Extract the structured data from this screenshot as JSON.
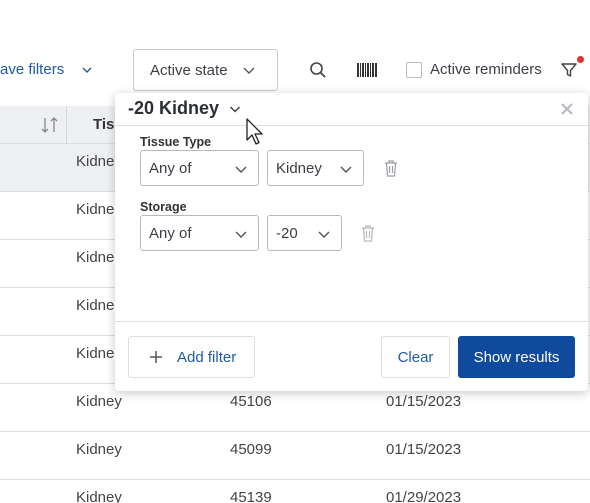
{
  "toolbar": {
    "save_filters_label": "ave filters",
    "active_state_label": "Active state",
    "active_reminders_label": "Active reminders",
    "active_reminders_checked": false,
    "icons": [
      "search-icon",
      "barcode-icon",
      "filter-icon"
    ],
    "filter_indicator_color": "#e0332e"
  },
  "table": {
    "visible_header": "Tiss",
    "rows": [
      {
        "tissue": "Kidne",
        "id": "",
        "date": "",
        "selected": true
      },
      {
        "tissue": "Kidne",
        "id": "",
        "date": ""
      },
      {
        "tissue": "Kidne",
        "id": "",
        "date": ""
      },
      {
        "tissue": "Kidne",
        "id": "",
        "date": ""
      },
      {
        "tissue": "Kidne",
        "id": "",
        "date": ""
      },
      {
        "tissue": "Kidney",
        "id": "45106",
        "date": "01/15/2023"
      },
      {
        "tissue": "Kidney",
        "id": "45099",
        "date": "01/15/2023"
      },
      {
        "tissue": "Kidney",
        "id": "45139",
        "date": "01/29/2023"
      }
    ]
  },
  "popup": {
    "title": "-20 Kidney",
    "filters": [
      {
        "label": "Tissue Type",
        "operator": "Any of",
        "value": "Kidney"
      },
      {
        "label": "Storage",
        "operator": "Any of",
        "value": "-20"
      }
    ],
    "add_filter_label": "Add filter",
    "clear_label": "Clear",
    "show_results_label": "Show results",
    "primary_color": "#0f4a9c",
    "link_color": "#1f5aa6"
  }
}
